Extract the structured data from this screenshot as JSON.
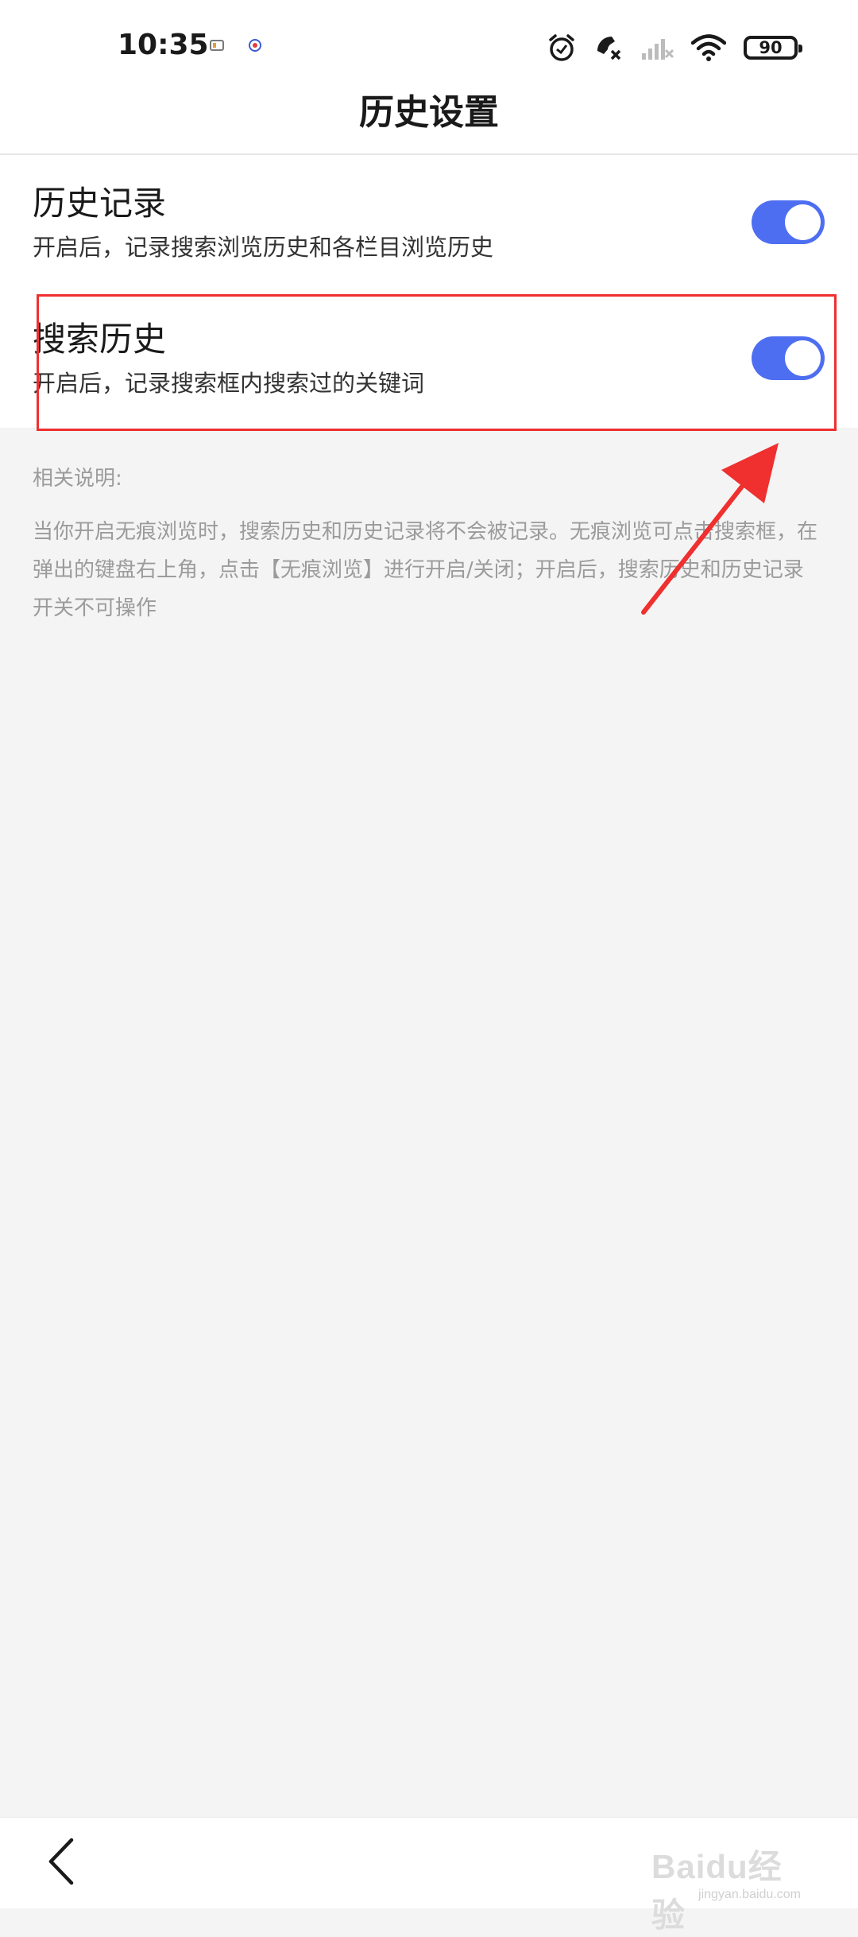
{
  "status_bar": {
    "time": "10:35",
    "battery_level": "90",
    "icons": [
      "notification-icon-1",
      "notification-icon-2",
      "alarm-icon",
      "call-muted-icon",
      "signal-no-service-icon",
      "wifi-icon",
      "battery-icon"
    ]
  },
  "header": {
    "title": "历史设置"
  },
  "settings": {
    "items": [
      {
        "title": "历史记录",
        "description": "开启后，记录搜索浏览历史和各栏目浏览历史",
        "enabled": true
      },
      {
        "title": "搜索历史",
        "description": "开启后，记录搜索框内搜索过的关键词",
        "enabled": true
      }
    ]
  },
  "note": {
    "title": "相关说明:",
    "body": "当你开启无痕浏览时，搜索历史和历史记录将不会被记录。无痕浏览可点击搜索框，在弹出的键盘右上角，点击【无痕浏览】进行开启/关闭；开启后，搜索历史和历史记录开关不可操作"
  },
  "bottom_bar": {
    "back_icon": "chevron-left-icon"
  },
  "watermark": {
    "brand": "Baidu经验",
    "url": "jingyan.baidu.com"
  },
  "colors": {
    "toggle_on": "#4e6ef2",
    "annotation": "#f02f2f"
  }
}
